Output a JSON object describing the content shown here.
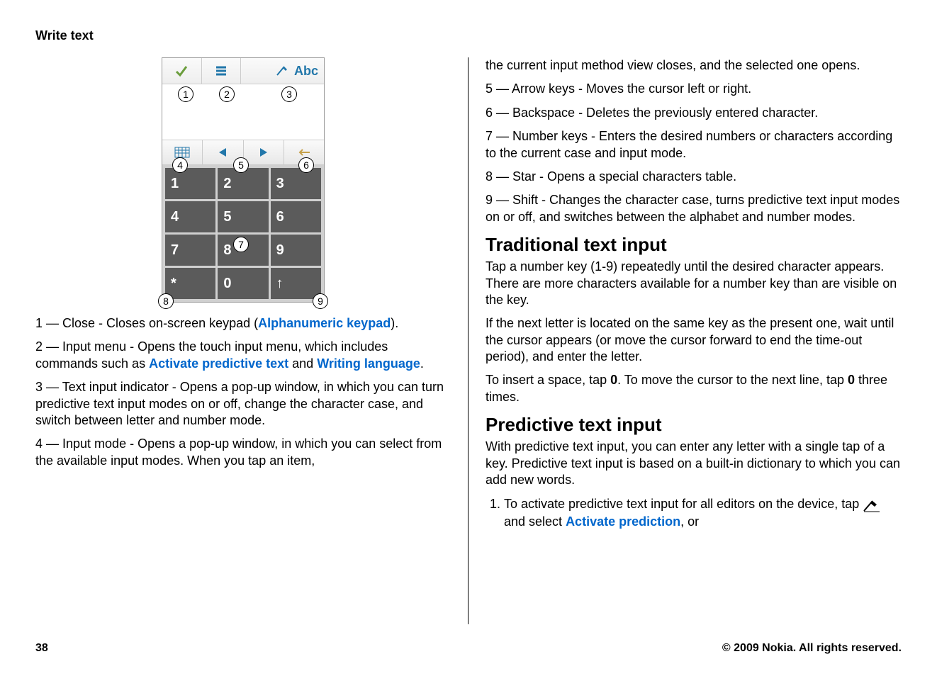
{
  "header": "Write text",
  "keypad": {
    "top_indicator": "Abc",
    "keys": [
      "1",
      "2",
      "3",
      "4",
      "5",
      "6",
      "7",
      "8",
      "9",
      "*",
      "0",
      "↑"
    ]
  },
  "left": {
    "item1_a": "1 — Close - Closes on-screen keypad (",
    "item1_link": "Alphanumeric keypad",
    "item1_b": ").",
    "item2_a": "2 — Input menu - Opens the touch input menu, which includes commands such as ",
    "item2_link1": "Activate predictive text",
    "item2_b": " and ",
    "item2_link2": "Writing language",
    "item2_c": ".",
    "item3": "3 — Text input indicator - Opens a pop-up window, in which you can turn predictive text input modes on or off, change the character case, and switch between letter and number mode.",
    "item4": "4 — Input mode - Opens a pop-up window, in which you can select from the available input modes. When you tap an item,"
  },
  "right": {
    "cont": "the current input method view closes, and the selected one opens.",
    "item5": "5 — Arrow keys - Moves the cursor left or right.",
    "item6": "6 — Backspace - Deletes the previously entered character.",
    "item7": "7 — Number keys - Enters the desired numbers or characters according to the current case and input mode.",
    "item8": "8 — Star - Opens a special characters table.",
    "item9": "9 — Shift - Changes the character case, turns predictive text input modes on or off, and switches between the alphabet and number modes.",
    "h_trad": "Traditional text input",
    "trad_p1": "Tap a number key (1-9) repeatedly until the desired character appears. There are more characters available for a number key than are visible on the key.",
    "trad_p2": "If the next letter is located on the same key as the present one, wait until the cursor appears (or move the cursor forward to end the time-out period), and enter the letter.",
    "trad_p3_a": "To insert a space, tap ",
    "trad_p3_key1": "0",
    "trad_p3_b": ". To move the cursor to the next line, tap ",
    "trad_p3_key2": "0",
    "trad_p3_c": " three times.",
    "h_pred": "Predictive text input",
    "pred_p1": "With predictive text input, you can enter any letter with a single tap of a key. Predictive text input is based on a built-in dictionary to which you can add new words.",
    "pred_li1_a": "To activate predictive text input for all editors on the device, tap ",
    "pred_li1_b": " and select ",
    "pred_li1_link": "Activate prediction",
    "pred_li1_c": ", or"
  },
  "footer": {
    "page": "38",
    "copyright": "© 2009 Nokia. All rights reserved."
  }
}
